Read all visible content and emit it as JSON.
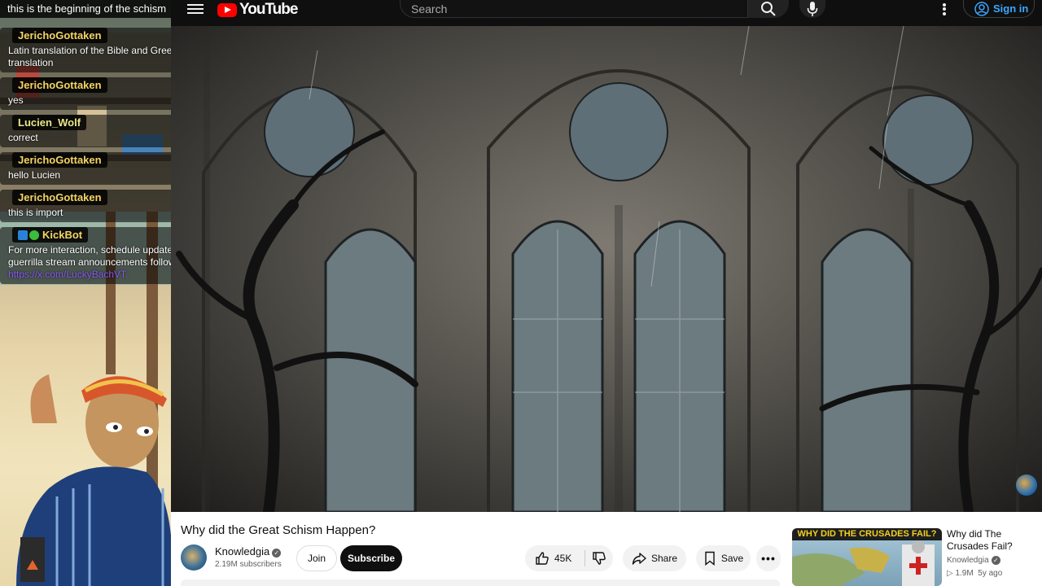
{
  "stream": {
    "title": "this is the beginning of the schism",
    "chat": [
      {
        "user": "JerichoGottaken",
        "text": "Latin translation of the Bible and Greek translation"
      },
      {
        "user": "JerichoGottaken",
        "text": "yes"
      },
      {
        "user": "Lucien_Wolf",
        "text": "correct"
      },
      {
        "user": "JerichoGottaken",
        "text": "hello Lucien"
      },
      {
        "user": "JerichoGottaken",
        "text": "this is import"
      },
      {
        "user": "KickBot",
        "text": "For more interaction, schedule updates, and guerrilla stream announcements follow @ ",
        "link": "https://x.com/LuckyBachVT."
      }
    ]
  },
  "header": {
    "logo_text": "YouTube",
    "search_placeholder": "Search",
    "sign_in": "Sign in"
  },
  "video": {
    "title": "Why did the Great Schism Happen?",
    "channel": "Knowledgia",
    "subscribers": "2.19M subscribers",
    "join": "Join",
    "subscribe": "Subscribe",
    "likes": "45K",
    "share": "Share",
    "save": "Save",
    "more": "•••"
  },
  "recommended": {
    "thumb_banner": "WHY DID THE CRUSADES FAIL?",
    "title": "Why did The Crusades Fail?",
    "channel": "Knowledgia",
    "views": "1.9M",
    "age": "5y ago"
  },
  "colors": {
    "brand_red": "#ff0000",
    "link_blue": "#3ea6ff",
    "chat_name": "#f4d463"
  }
}
